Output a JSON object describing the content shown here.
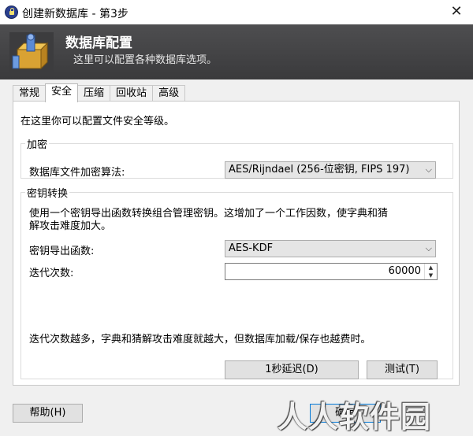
{
  "window": {
    "title": "创建新数据库 - 第3步",
    "close_glyph": "✕"
  },
  "banner": {
    "title": "数据库配置",
    "subtitle": "这里可以配置各种数据库选项。"
  },
  "tabs": [
    {
      "label": "常规"
    },
    {
      "label": "安全"
    },
    {
      "label": "压缩"
    },
    {
      "label": "回收站"
    },
    {
      "label": "高级"
    }
  ],
  "active_tab": "安全",
  "intro": "在这里你可以配置文件安全等级。",
  "encryption": {
    "legend": "加密",
    "algorithm_label": "数据库文件加密算法:",
    "algorithm_value": "AES/Rijndael (256-位密钥, FIPS 197)"
  },
  "key_transform": {
    "legend": "密钥转换",
    "description_line1": "使用一个密钥导出函数转换组合管理密钥。这增加了一个工作因数，使字典和猜",
    "description_line2": "解攻击难度加大。",
    "kdf_label": "密钥导出函数:",
    "kdf_value": "AES-KDF",
    "iterations_label": "迭代次数:",
    "iterations_value": "60000",
    "note": "迭代次数越多，字典和猜解攻击难度就越大，但数据库加载/保存也越费时。",
    "delay_button": "1秒延迟(D)",
    "test_button": "测试(T)"
  },
  "footer": {
    "help_button": "帮助(H)",
    "ok_button": "确定"
  },
  "watermark": "人人软件园",
  "colors": {
    "banner_bg": "#3f3f41",
    "panel_bg": "#ffffff",
    "window_bg": "#f0f0f0"
  }
}
